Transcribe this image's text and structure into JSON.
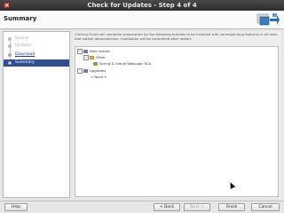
{
  "window": {
    "title": "Check for Updates - Step 4 of 4"
  },
  "header": {
    "title": "Summary"
  },
  "steps": [
    {
      "label": "Source",
      "state": "done"
    },
    {
      "label": "Updates",
      "state": "done"
    },
    {
      "label": "Download",
      "state": "link"
    },
    {
      "label": "Summary",
      "state": "active"
    }
  ],
  "description": "Clicking Finish will complete preparation for the following bundles to be installed with corresponding features in all roles that satisfy dependencies. Installation will be completed after restart.",
  "tree": {
    "new_installs": "New Installs",
    "other": "Other",
    "item": "Spring & Oracle WebLogic SCA",
    "upgrades": "Upgrades",
    "none": "< None >"
  },
  "buttons": {
    "help": "Help",
    "back": "< Back",
    "next": "Next >",
    "finish": "Finish",
    "cancel": "Cancel"
  }
}
